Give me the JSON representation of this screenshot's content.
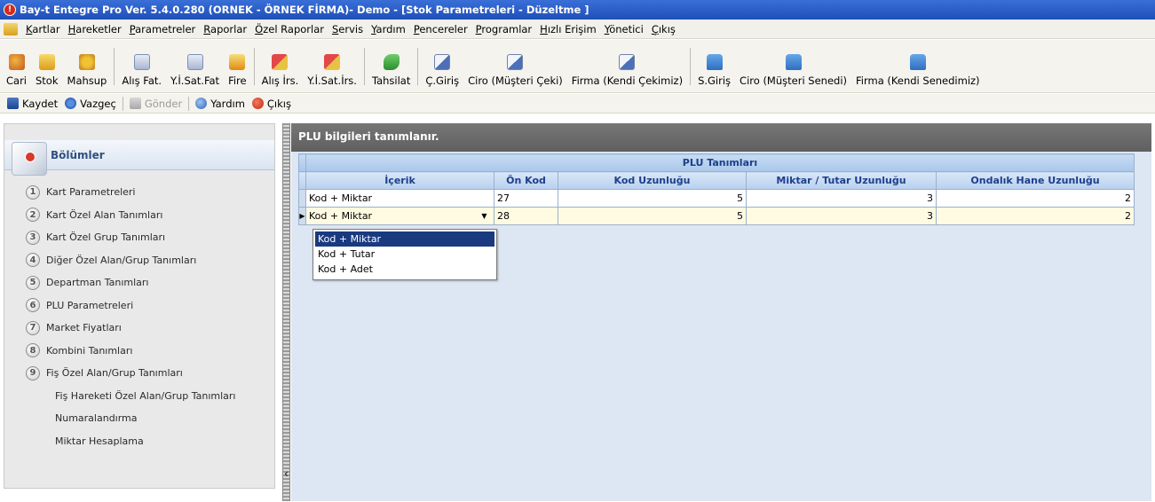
{
  "window": {
    "title": "Bay-t Entegre Pro Ver. 5.4.0.280 (ORNEK - ÖRNEK FİRMA)- Demo - [Stok Parametreleri - Düzeltme ]"
  },
  "menubar": [
    "Kartlar",
    "Hareketler",
    "Parametreler",
    "Raporlar",
    "Özel Raporlar",
    "Servis",
    "Yardım",
    "Pencereler",
    "Programlar",
    "Hızlı Erişim",
    "Yönetici",
    "Çıkış"
  ],
  "toolbar": {
    "cari": "Cari",
    "stok": "Stok",
    "mahsup": "Mahsup",
    "alis_fat": "Alış Fat.",
    "yisat_fat": "Y.İ.Sat.Fat",
    "fire": "Fire",
    "alis_irs": "Alış İrs.",
    "yisat_irs": "Y.İ.Sat.İrs.",
    "tahsilat": "Tahsilat",
    "c_giris": "Ç.Giriş",
    "ciro_cek": "Ciro (Müşteri Çeki)",
    "firma_cek": "Firma (Kendi Çekimiz)",
    "s_giris": "S.Giriş",
    "ciro_senet": "Ciro (Müşteri Senedi)",
    "firma_senet": "Firma (Kendi Senedimiz)"
  },
  "actions": {
    "kaydet": "Kaydet",
    "vazgec": "Vazgeç",
    "gonder": "Gönder",
    "yardim": "Yardım",
    "cikis": "Çıkış"
  },
  "sidebar": {
    "title": "Bölümler",
    "items": [
      {
        "num": "1",
        "label": "Kart Parametreleri"
      },
      {
        "num": "2",
        "label": "Kart Özel Alan Tanımları"
      },
      {
        "num": "3",
        "label": "Kart Özel Grup Tanımları"
      },
      {
        "num": "4",
        "label": "Diğer Özel Alan/Grup Tanımları"
      },
      {
        "num": "5",
        "label": "Departman Tanımları"
      },
      {
        "num": "6",
        "label": "PLU Parametreleri"
      },
      {
        "num": "7",
        "label": "Market Fiyatları"
      },
      {
        "num": "8",
        "label": "Kombini Tanımları"
      },
      {
        "num": "9",
        "label": "Fiş Özel Alan/Grup Tanımları"
      },
      {
        "num": "",
        "label": "Fiş Hareketi Özel Alan/Grup Tanımları"
      },
      {
        "num": "",
        "label": "Numaralandırma"
      },
      {
        "num": "",
        "label": "Miktar Hesaplama"
      }
    ]
  },
  "panel": {
    "header": "PLU bilgileri tanımlanır.",
    "band": "PLU Tanımları",
    "columns": [
      "İçerik",
      "Ön Kod",
      "Kod Uzunluğu",
      "Miktar / Tutar Uzunluğu",
      "Ondalık Hane Uzunluğu"
    ],
    "rows": [
      [
        "Kod + Miktar",
        "27",
        "5",
        "3",
        "2"
      ],
      [
        "Kod + Miktar",
        "28",
        "5",
        "3",
        "2"
      ]
    ],
    "dropdown_options": [
      "Kod + Miktar",
      "Kod + Tutar",
      "Kod + Adet"
    ],
    "dropdown_selected": "Kod + Miktar"
  },
  "colors": {
    "title_bar": "#1f4fb8",
    "grid_header_text": "#1e3f8c",
    "selected_option": "#1a3a80",
    "active_row": "#fffbe2"
  }
}
